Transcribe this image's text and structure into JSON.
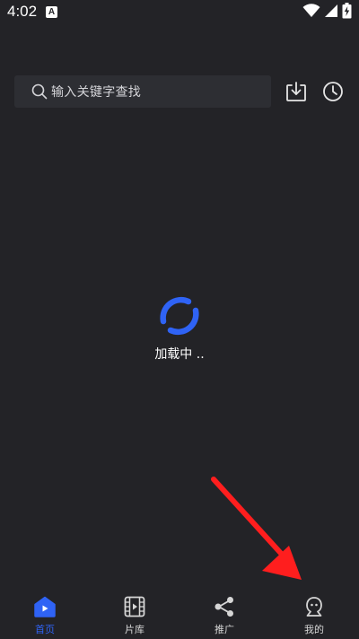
{
  "status_bar": {
    "time": "4:02",
    "app_icon_letter": "A",
    "wifi_icon": "wifi-icon",
    "signal_icon": "cellular-signal-icon",
    "battery_icon": "battery-charging-icon"
  },
  "header": {
    "search_placeholder": "输入关键字查找",
    "search_icon": "search-icon",
    "download_icon": "download-icon",
    "history_icon": "clock-icon"
  },
  "loader": {
    "text": "加载中 ..",
    "accent": "#2F63F5"
  },
  "annotation": {
    "type": "arrow",
    "color": "#FF1E1E",
    "points_to": "nav-item-mine"
  },
  "bottom_nav": {
    "items": [
      {
        "label": "首页",
        "icon": "home-play-icon",
        "active": true
      },
      {
        "label": "片库",
        "icon": "film-library-icon",
        "active": false
      },
      {
        "label": "推广",
        "icon": "share-icon",
        "active": false
      },
      {
        "label": "我的",
        "icon": "profile-icon",
        "active": false
      }
    ],
    "active_color": "#2F63F5",
    "inactive_color": "#D6D6D6"
  },
  "colors": {
    "background": "#232327",
    "search_background": "#2D2E33"
  }
}
